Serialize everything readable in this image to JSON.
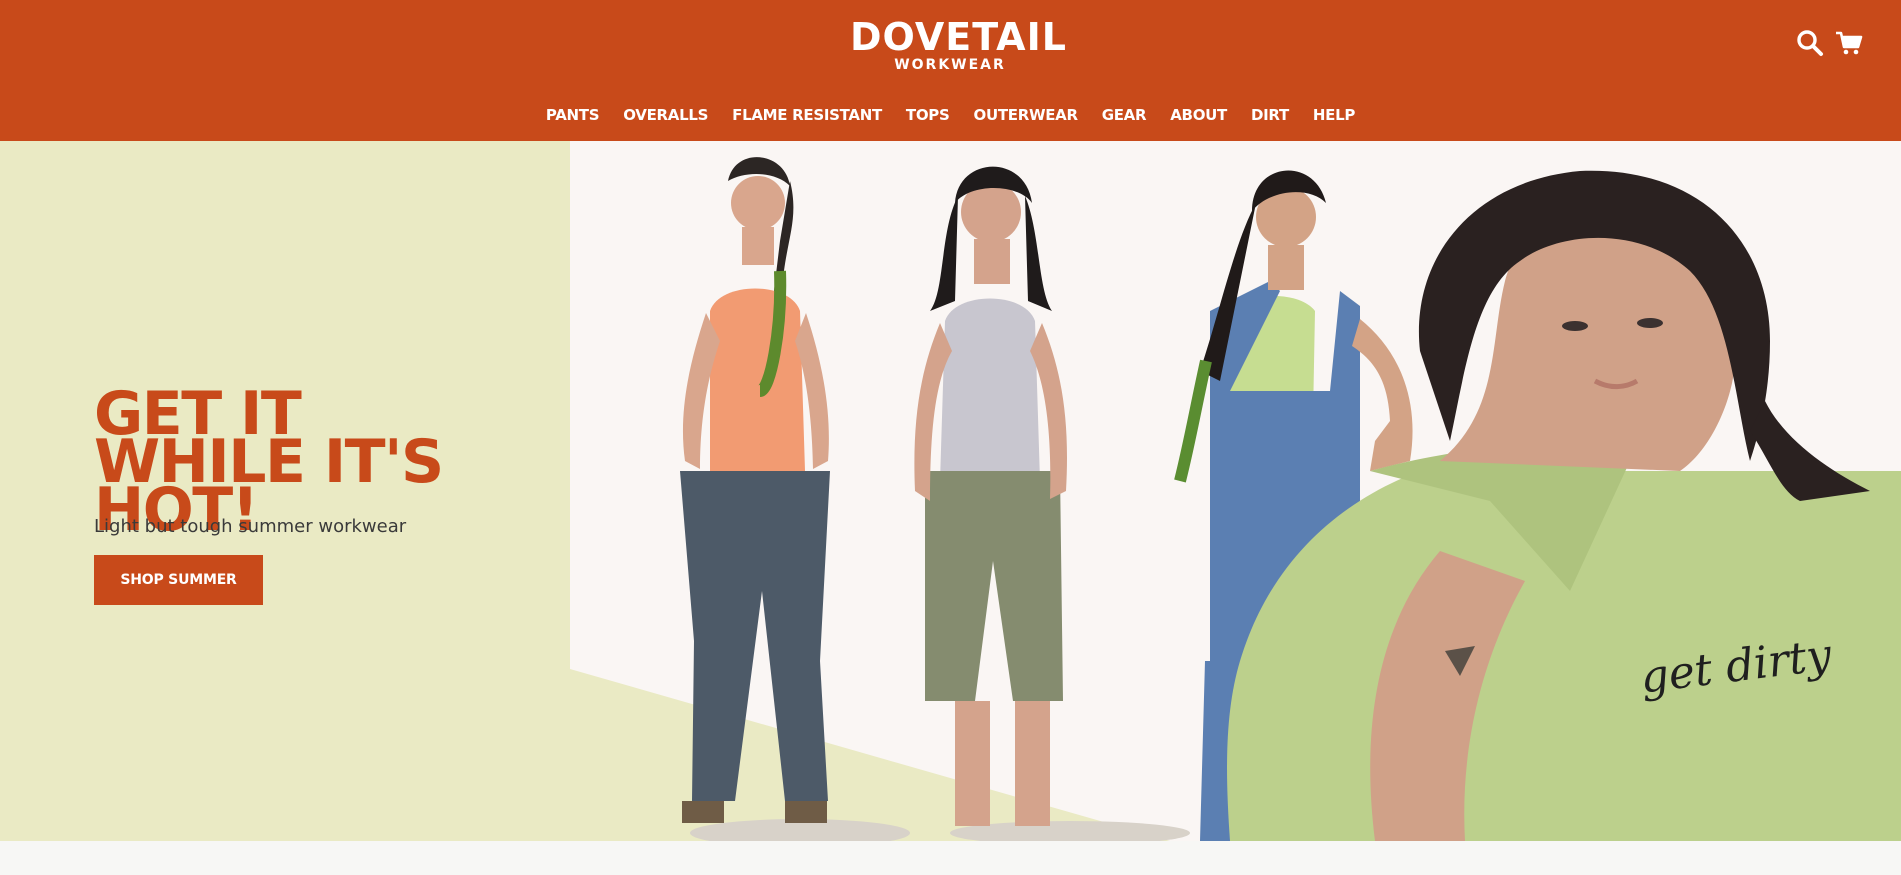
{
  "header": {
    "logo_main": "DOVETAIL",
    "logo_sub": "WORKWEAR",
    "background_color": "#c84a1a",
    "icons": [
      "search-icon",
      "cart-icon"
    ]
  },
  "nav": {
    "items": [
      {
        "label": "PANTS"
      },
      {
        "label": "OVERALLS"
      },
      {
        "label": "FLAME RESISTANT"
      },
      {
        "label": "TOPS"
      },
      {
        "label": "OUTERWEAR"
      },
      {
        "label": "GEAR"
      },
      {
        "label": "ABOUT"
      },
      {
        "label": "DIRT"
      },
      {
        "label": "HELP"
      }
    ]
  },
  "hero": {
    "title": "GET IT WHILE IT'S HOT!",
    "subtitle": "Light but tough summer workwear",
    "cta_label": "SHOP SUMMER",
    "shirt_text": "get dirty",
    "left_panel_color": "#eaeac4",
    "accent_color": "#c84a1a"
  }
}
